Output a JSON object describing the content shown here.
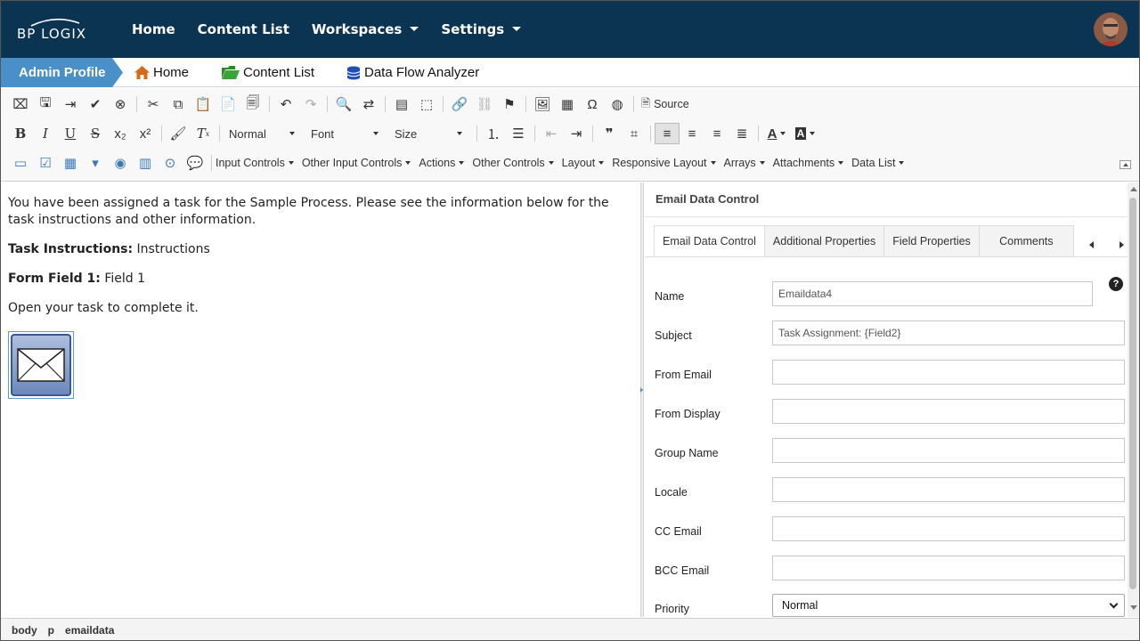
{
  "app": {
    "logo_text": "BP LOGIX"
  },
  "topnav": {
    "items": [
      {
        "label": "Home"
      },
      {
        "label": "Content List"
      },
      {
        "label": "Workspaces"
      },
      {
        "label": "Settings"
      }
    ]
  },
  "subbar": {
    "admin_profile": "Admin Profile",
    "home": "Home",
    "content_list": "Content List",
    "data_flow": "Data Flow Analyzer"
  },
  "toolbar": {
    "source_label": "Source",
    "format_combo": "Normal",
    "font_combo": "Font",
    "size_combo": "Size",
    "menus": [
      "Input Controls",
      "Other Input Controls",
      "Actions",
      "Other Controls",
      "Layout",
      "Responsive Layout",
      "Arrays",
      "Attachments",
      "Data List"
    ]
  },
  "editor": {
    "intro": "You have been assigned a task for the Sample Process. Please see the information below for the task instructions and other information.",
    "task_label": "Task Instructions:",
    "task_value": " Instructions",
    "field_label": "Form Field 1:",
    "field_value": " Field 1",
    "closing": "Open your task to complete it."
  },
  "panel": {
    "title": "Email Data Control",
    "tabs": [
      "Email Data Control",
      "Additional Properties",
      "Field Properties",
      "Comments"
    ],
    "fields": {
      "name": {
        "label": "Name",
        "value": "Emaildata4"
      },
      "subject": {
        "label": "Subject",
        "value": "Task Assignment: {Field2}"
      },
      "from_email": {
        "label": "From Email",
        "value": ""
      },
      "from_display": {
        "label": "From Display",
        "value": ""
      },
      "group_name": {
        "label": "Group Name",
        "value": ""
      },
      "locale": {
        "label": "Locale",
        "value": ""
      },
      "cc_email": {
        "label": "CC Email",
        "value": ""
      },
      "bcc_email": {
        "label": "BCC Email",
        "value": ""
      },
      "priority": {
        "label": "Priority",
        "value": "Normal"
      }
    },
    "help_glyph": "?"
  },
  "statusbar": {
    "path": [
      "body",
      "p",
      "emaildata"
    ]
  },
  "colors": {
    "nav_bg": "#0b3352",
    "accent": "#4a90c8"
  }
}
